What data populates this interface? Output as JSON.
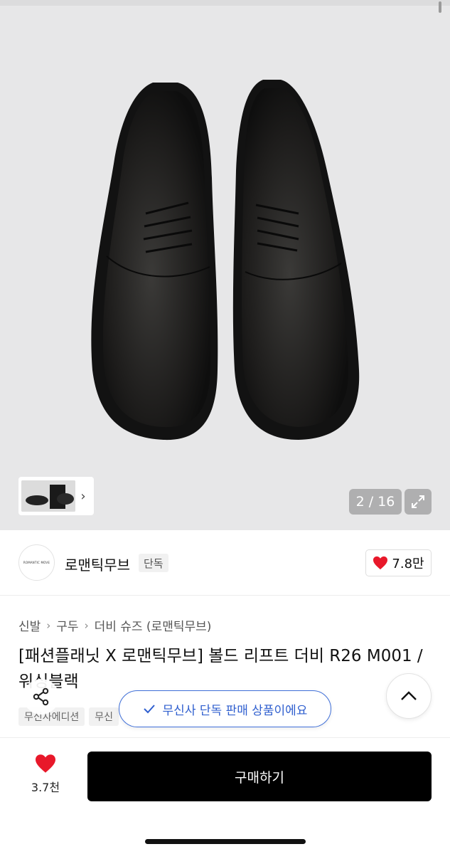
{
  "gallery": {
    "counter": "2 / 16",
    "thumb_next_icon": "chevron-right-icon",
    "expand_icon": "expand-icon"
  },
  "brand": {
    "logo_text": "ROMANTIC MOVE",
    "name": "로맨틱무브",
    "tag": "단독",
    "likes": "7.8만",
    "heart_color": "#e8182a"
  },
  "breadcrumb": [
    "신발",
    "구두",
    "더비 슈즈 (로맨틱무브)"
  ],
  "product": {
    "title": "[패션플래닛 X 로맨틱무브] 볼드 리프트 더비 R26 M001 / 워싱블랙",
    "chips": [
      "무신사에디션",
      "무신"
    ]
  },
  "toast": {
    "icon": "check-icon",
    "text": "무신사 단독 판매 상품이에요",
    "accent": "#2f5fcf"
  },
  "bottom": {
    "fav_count": "3.7천",
    "buy_label": "구매하기"
  }
}
